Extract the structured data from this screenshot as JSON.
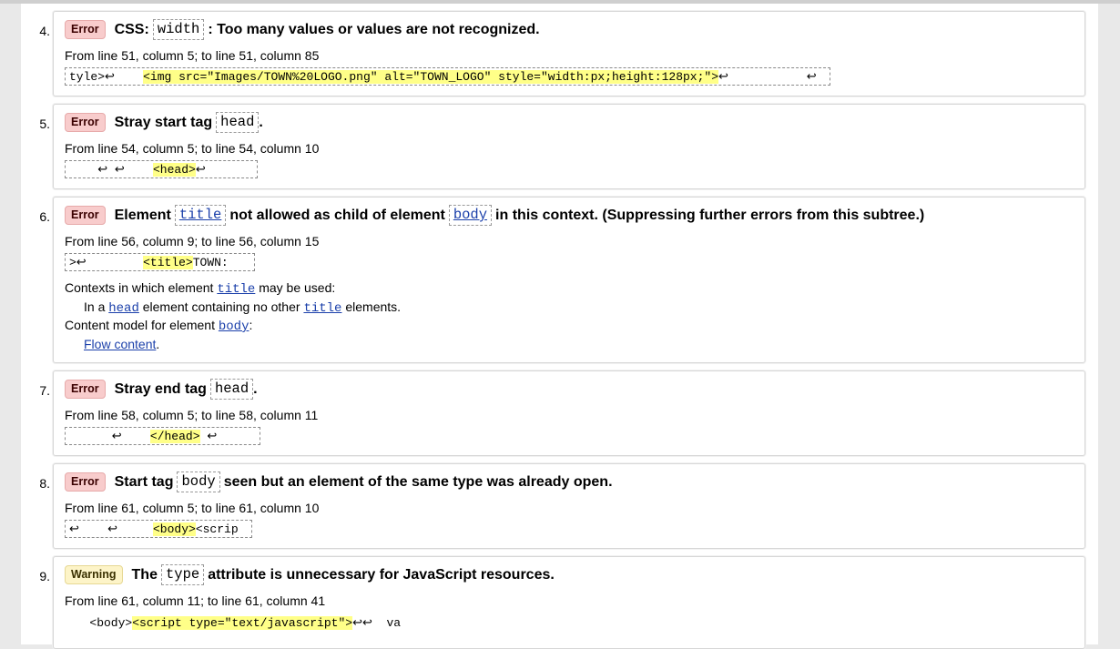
{
  "messages": [
    {
      "number": "4.",
      "badge": "Error",
      "pre": "CSS:",
      "code1": "width",
      "post": ": Too many values or values are not recognized.",
      "location": "From line 51, column 5; to line 51, column 85",
      "extract_pre": "tyle>↩    ",
      "extract_hl": "<img src=\"Images/TOWN%20LOGO.png\" alt=\"TOWN_LOGO\" style=\"width:px;height:128px;\">",
      "extract_post": "↩           ↩"
    },
    {
      "number": "5.",
      "badge": "Error",
      "pre": "Stray start tag",
      "code1": "head",
      "post": ".",
      "location": "From line 54, column 5; to line 54, column 10",
      "extract_pre": "    ↩ ↩    ",
      "extract_hl": "<head>",
      "extract_post": "↩"
    },
    {
      "number": "6.",
      "badge": "Error",
      "pre": "Element",
      "code1": "title",
      "mid": "not allowed as child of element",
      "code2": "body",
      "post": "in this context. (Suppressing further errors from this subtree.)",
      "location": "From line 56, column 9; to line 56, column 15",
      "extract_pre": ">↩        ",
      "extract_hl": "<title>",
      "extract_post": "TOWN:",
      "ctx_line1_pre": "Contexts in which element",
      "ctx_line1_code": "title",
      "ctx_line1_post": "may be used:",
      "ctx_line2_pre": "In a",
      "ctx_line2_code": "head",
      "ctx_line2_mid": "element containing no other",
      "ctx_line2_code2": "title",
      "ctx_line2_post": "elements.",
      "ctx_line3_pre": "Content model for element",
      "ctx_line3_code": "body",
      "ctx_line3_post": ":",
      "ctx_line4": "Flow content",
      "ctx_line4_post": "."
    },
    {
      "number": "7.",
      "badge": "Error",
      "pre": "Stray end tag",
      "code1": "head",
      "post": ".",
      "location": "From line 58, column 5; to line 58, column 11",
      "extract_pre": "      ↩    ",
      "extract_hl": "</head>",
      "extract_post": " ↩"
    },
    {
      "number": "8.",
      "badge": "Error",
      "pre": "Start tag",
      "code1": "body",
      "post": "seen but an element of the same type was already open.",
      "location": "From line 61, column 5; to line 61, column 10",
      "extract_pre": "↩    ↩     ",
      "extract_hl": "<body>",
      "extract_post": "<scrip"
    },
    {
      "number": "9.",
      "badge": "Warning",
      "pre": "The",
      "code1": "type",
      "post": "attribute is unnecessary for JavaScript resources.",
      "location": "From line 61, column 11; to line 61, column 41",
      "extract_pre": "   <body>",
      "extract_hl": "<script type=\"text/javascript\">",
      "extract_post": "↩↩  va"
    }
  ]
}
